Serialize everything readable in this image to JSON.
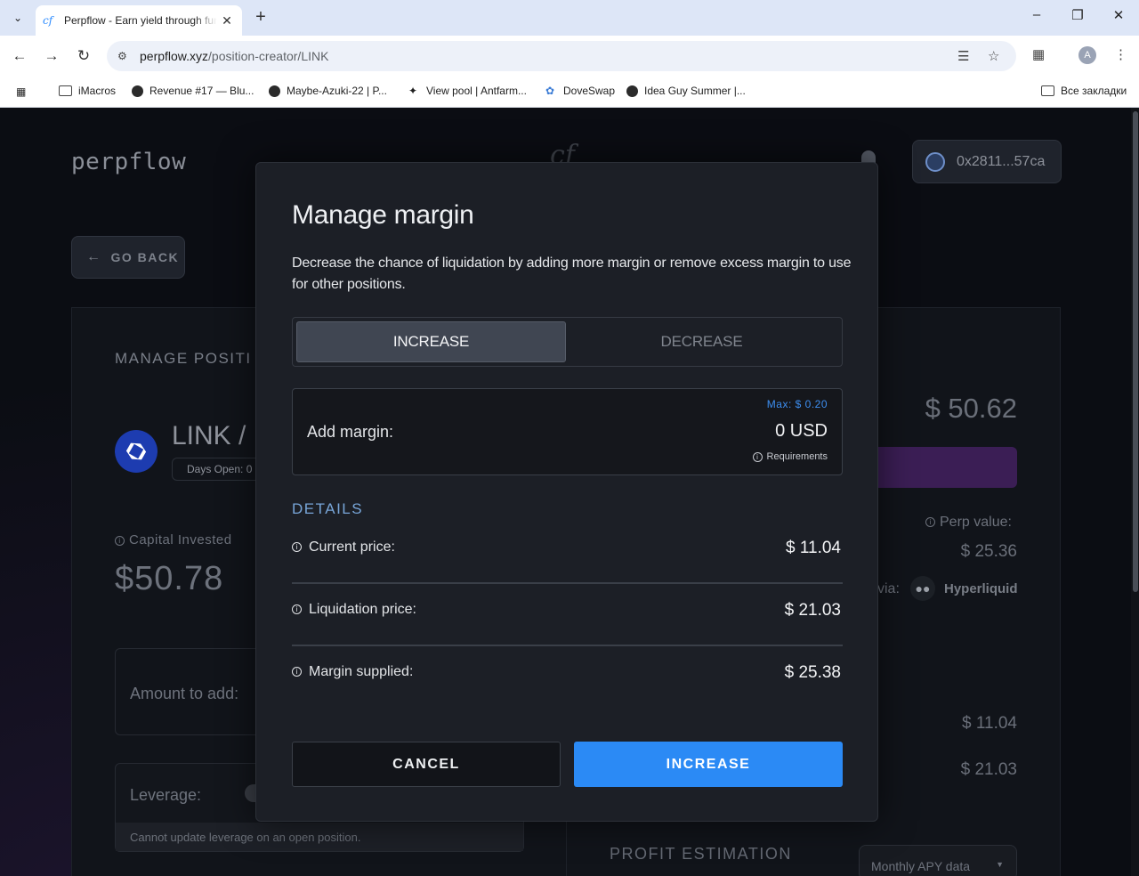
{
  "browser": {
    "tab_title": "Perpflow - Earn yield through funding rates",
    "tab_favicon": "cf",
    "url_host": "perpflow.xyz",
    "url_path": "/position-creator/LINK",
    "avatar_letter": "A",
    "bookmarks": [
      {
        "label": "iMacros",
        "icon": "folder-icon"
      },
      {
        "label": "Revenue #17 — Blu...",
        "icon": "site-icon"
      },
      {
        "label": "Maybe-Azuki-22 | P...",
        "icon": "site-icon"
      },
      {
        "label": "View pool | Antfarm...",
        "icon": "site-icon"
      },
      {
        "label": "DoveSwap",
        "icon": "site-icon"
      },
      {
        "label": "Idea Guy Summer |...",
        "icon": "site-icon"
      }
    ],
    "all_bookmarks": "Все закладки"
  },
  "app": {
    "logo": "perpflow",
    "wallet": "0x2811...57ca",
    "go_back": "GO BACK",
    "manage_position": "MANAGE POSITI",
    "pair": "LINK / U",
    "days_open": "Days Open: 0",
    "capital_label": "Capital Invested",
    "capital_value": "$50.78",
    "amount_to_add": "Amount to add:",
    "leverage": "Leverage:",
    "leverage_note": "Cannot update leverage on an open position.",
    "right_total": "$ 50.62",
    "perp_value_label": "Perp value:",
    "perp_value": "$ 25.36",
    "via_label": "via:",
    "via_exchange": "Hyperliquid",
    "right_price": "$ 11.04",
    "right_liq": "$ 21.03",
    "profit_estimation": "PROFIT ESTIMATION",
    "apy_select": "Monthly APY data"
  },
  "modal": {
    "title": "Manage margin",
    "description": "Decrease the chance of liquidation by adding more margin or remove excess margin to use for other positions.",
    "tab_increase": "INCREASE",
    "tab_decrease": "DECREASE",
    "add_margin_label": "Add margin:",
    "max": "Max: $ 0.20",
    "margin_value": "0 USD",
    "requirements": "Requirements",
    "details_heading": "DETAILS",
    "details": [
      {
        "label": "Current price:",
        "value": "$ 11.04"
      },
      {
        "label": "Liquidation price:",
        "value": "$ 21.03"
      },
      {
        "label": "Margin supplied:",
        "value": "$ 25.38"
      }
    ],
    "cancel": "CANCEL",
    "confirm": "INCREASE"
  },
  "colors": {
    "accent": "#2b8af5",
    "modal_bg": "#1c1f26",
    "page_bg": "#0b0d13"
  }
}
